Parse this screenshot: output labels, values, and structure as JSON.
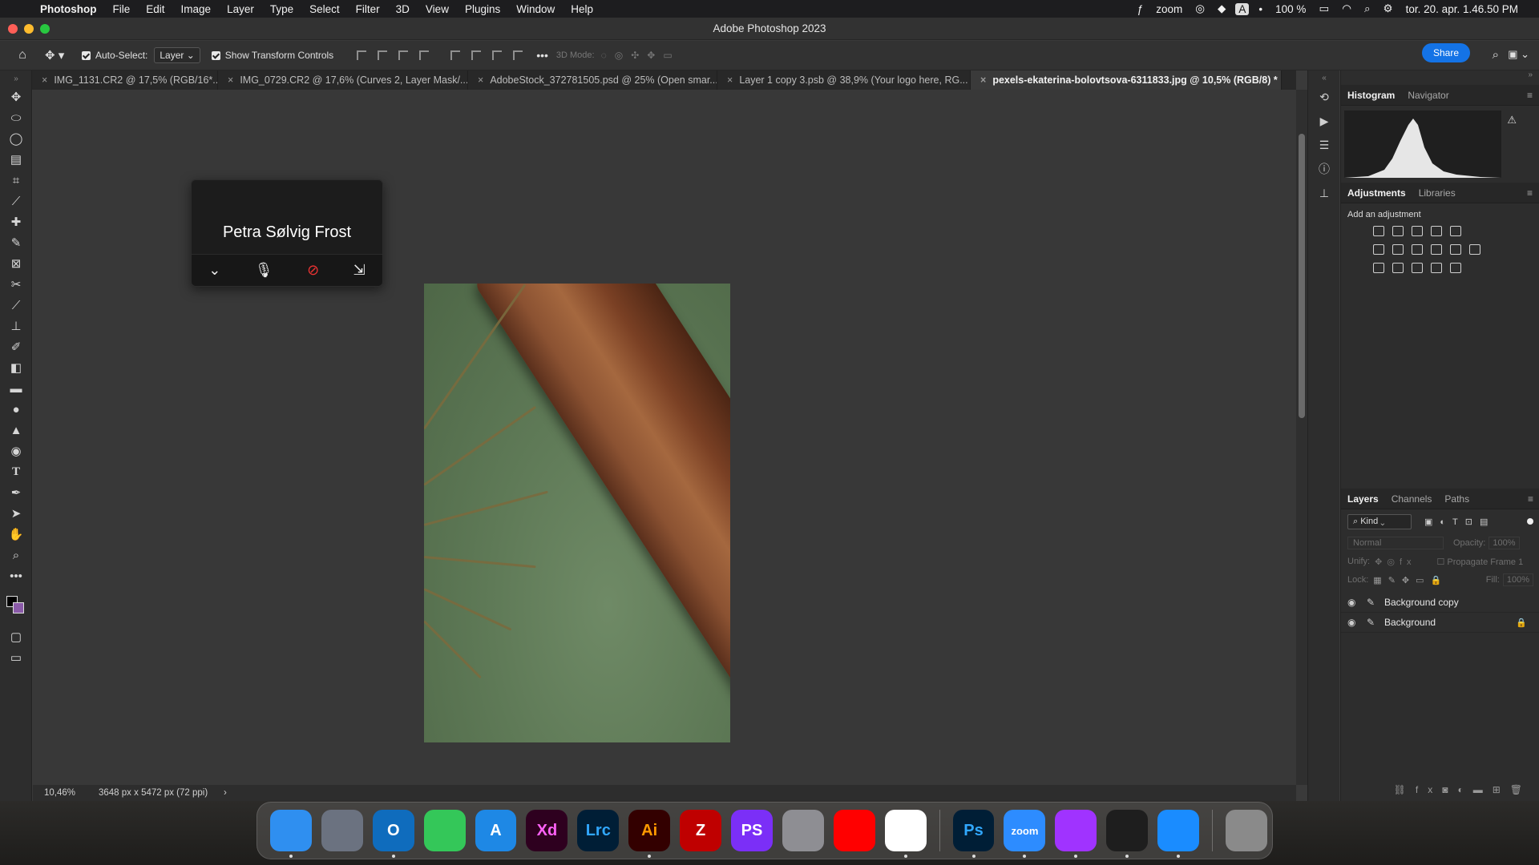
{
  "menubar": {
    "app_name": "Photoshop",
    "items": [
      "File",
      "Edit",
      "Image",
      "Layer",
      "Type",
      "Select",
      "Filter",
      "3D",
      "View",
      "Plugins",
      "Window",
      "Help"
    ],
    "status_items": [
      "zoom",
      "A",
      "100 %",
      "tor. 20. apr.  1.46.50 PM"
    ]
  },
  "window": {
    "title": "Adobe Photoshop 2023"
  },
  "options": {
    "auto_select_label": "Auto-Select:",
    "auto_select_value": "Layer",
    "show_transform_label": "Show Transform Controls",
    "mode_label": "3D Mode:",
    "share_label": "Share"
  },
  "tabs": [
    {
      "label": "IMG_1131.CR2 @ 17,5% (RGB/16*..."
    },
    {
      "label": "IMG_0729.CR2 @ 17,6% (Curves 2, Layer Mask/..."
    },
    {
      "label": "AdobeStock_372781505.psd @ 25% (Open smar..."
    },
    {
      "label": "Layer 1 copy 3.psb @ 38,9% (Your logo here, RG..."
    },
    {
      "label": "pexels-ekaterina-bolovtsova-6311833.jpg @ 10,5% (RGB/8) *"
    }
  ],
  "zoom_widget": {
    "participant_name": "Petra Sølvig Frost"
  },
  "status": {
    "zoom_level": "10,46%",
    "doc_info": "3648 px x 5472 px (72 ppi)",
    "arrow": "›"
  },
  "panels": {
    "histogram_tab": "Histogram",
    "navigator_tab": "Navigator",
    "adjustments_tab": "Adjustments",
    "libraries_tab": "Libraries",
    "add_adjustment": "Add an adjustment",
    "layers_tab": "Layers",
    "channels_tab": "Channels",
    "paths_tab": "Paths",
    "kind_label": "Kind",
    "blend_mode": "Normal",
    "opacity_label": "Opacity:",
    "opacity_value": "100%",
    "unify_label": "Unify:",
    "propagate_label": "Propagate Frame 1",
    "lock_label": "Lock:",
    "fill_label": "Fill:",
    "fill_value": "100%",
    "layers": [
      {
        "name": "Background copy",
        "locked": false
      },
      {
        "name": "Background",
        "locked": true
      }
    ]
  },
  "dock": {
    "apps": [
      {
        "name": "Finder",
        "label": "",
        "color": "#2f8ff0",
        "icon": "finder-icon",
        "running": true
      },
      {
        "name": "Launchpad",
        "label": "",
        "color": "#6b7280",
        "icon": "launchpad-icon",
        "running": false
      },
      {
        "name": "Outlook",
        "label": "O",
        "color": "#0f6cbd",
        "icon": "outlook-icon",
        "running": true
      },
      {
        "name": "Messages",
        "label": "",
        "color": "#34c759",
        "icon": "messages-icon",
        "running": false
      },
      {
        "name": "App Store",
        "label": "A",
        "color": "#1e88e5",
        "icon": "appstore-icon",
        "running": false
      },
      {
        "name": "Adobe XD",
        "label": "Xd",
        "color": "#2e001f",
        "icon": "xd-icon",
        "running": false
      },
      {
        "name": "Lightroom Classic",
        "label": "Lrc",
        "color": "#001e36",
        "icon": "lrc-icon",
        "running": false
      },
      {
        "name": "Illustrator",
        "label": "Ai",
        "color": "#330000",
        "icon": "ai-icon",
        "running": true
      },
      {
        "name": "FileZilla",
        "label": "Z",
        "color": "#bf0000",
        "icon": "filezilla-icon",
        "running": false
      },
      {
        "name": "PhpStorm",
        "label": "PS",
        "color": "#7b2ff7",
        "icon": "phpstorm-icon",
        "running": false
      },
      {
        "name": "System Settings",
        "label": "",
        "color": "#8e8e93",
        "icon": "settings-icon",
        "running": false
      },
      {
        "name": "YouTube",
        "label": "",
        "color": "#ff0000",
        "icon": "youtube-icon",
        "running": false
      },
      {
        "name": "Chrome",
        "label": "",
        "color": "#ffffff",
        "icon": "chrome-icon",
        "running": true
      },
      {
        "name": "Photoshop",
        "label": "Ps",
        "color": "#001e36",
        "icon": "photoshop-icon",
        "running": true
      },
      {
        "name": "Zoom",
        "label": "zoom",
        "color": "#2d8cff",
        "icon": "zoom-icon",
        "running": true
      },
      {
        "name": "Messenger",
        "label": "",
        "color": "#a033ff",
        "icon": "messenger-icon",
        "running": true
      },
      {
        "name": "Figma",
        "label": "",
        "color": "#1e1e1e",
        "icon": "figma-icon",
        "running": true
      },
      {
        "name": "Mail",
        "label": "",
        "color": "#1a8cff",
        "icon": "mail-icon",
        "running": true
      },
      {
        "name": "Trash",
        "label": "",
        "color": "#8a8a8a",
        "icon": "trash-icon",
        "running": false
      }
    ]
  }
}
